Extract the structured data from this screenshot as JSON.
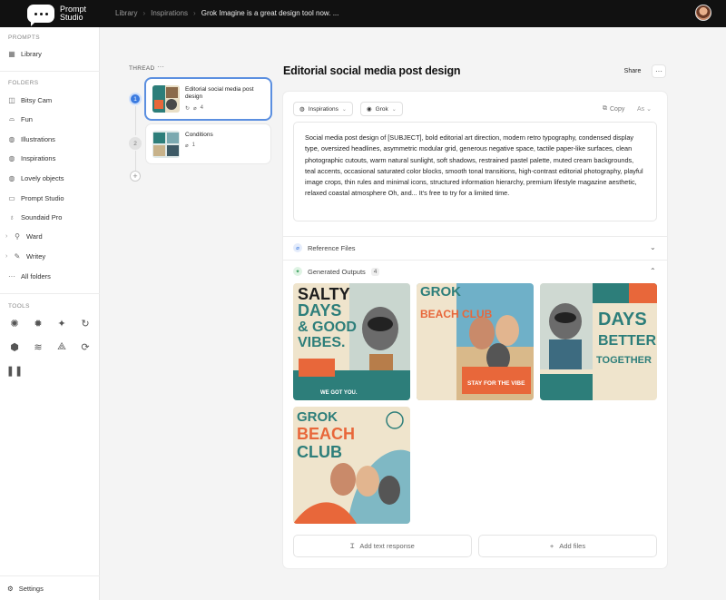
{
  "app": {
    "name_line1": "Prompt",
    "name_line2": "Studio"
  },
  "breadcrumb": [
    "Library",
    "Inspirations",
    "Grok Imagine is a great design tool now. ..."
  ],
  "sidebar": {
    "prompts_label": "PROMPTS",
    "library_label": "Library",
    "folders_label": "FOLDERS",
    "folders": [
      {
        "label": "Bitsy Cam",
        "icon": "camera-icon"
      },
      {
        "label": "Fun",
        "icon": "hat-icon"
      },
      {
        "label": "Illustrations",
        "icon": "palette-icon"
      },
      {
        "label": "Inspirations",
        "icon": "palette-icon"
      },
      {
        "label": "Lovely objects",
        "icon": "palette-icon"
      },
      {
        "label": "Prompt Studio",
        "icon": "folder-icon"
      },
      {
        "label": "Soundaid Pro",
        "icon": "mic-icon"
      },
      {
        "label": "Ward",
        "icon": "pin-icon"
      },
      {
        "label": "Writey",
        "icon": "pen-icon"
      }
    ],
    "all_folders_label": "All folders",
    "tools_label": "TOOLS",
    "settings_label": "Settings"
  },
  "thread": {
    "label": "THREAD",
    "items": [
      {
        "step": "1",
        "title": "Editorial social media post design",
        "count": "4"
      },
      {
        "step": "2",
        "title": "Conditions",
        "count": "1"
      }
    ]
  },
  "main": {
    "title": "Editorial social media post design",
    "share_label": "Share",
    "folder_chip": "Inspirations",
    "model_chip": "Grok",
    "copy_label": "Copy",
    "as_label": "As",
    "prompt_text": "Social media post design of [SUBJECT], bold editorial art direction, modern retro typography, condensed display type, oversized headlines, asymmetric modular grid, generous negative space, tactile paper-like surfaces, clean photographic cutouts, warm natural sunlight, soft shadows, restrained pastel palette, muted cream backgrounds, teal accents, occasional saturated color blocks, smooth tonal transitions, high-contrast editorial photography, playful image crops, thin rules and minimal icons, structured information hierarchy, premium lifestyle magazine aesthetic, relaxed coastal atmosphere Oh, and... It's free to try for a limited time.",
    "reference_files_label": "Reference Files",
    "generated_outputs_label": "Generated Outputs",
    "generated_outputs_count": "4",
    "add_text_label": "Add text response",
    "add_files_label": "Add files"
  },
  "outputs": [
    {
      "headline": [
        "SALTY",
        "DAYS",
        "& GOOD",
        "VIBES."
      ],
      "tagline": "WE GOT YOU."
    },
    {
      "headline": [
        "GROK",
        "BEACH CLUB"
      ],
      "tagline": "STAY FOR THE VIBE"
    },
    {
      "headline": [
        "DAYS",
        "BETTER",
        "TOGETHER"
      ],
      "tagline": ""
    },
    {
      "headline": [
        "GROK",
        "BEACH",
        "CLUB"
      ],
      "tagline": ""
    }
  ],
  "colors": {
    "accent": "#3b7be0",
    "teal": "#2a8a86",
    "cream": "#efe4cc",
    "orange": "#e8673a"
  }
}
